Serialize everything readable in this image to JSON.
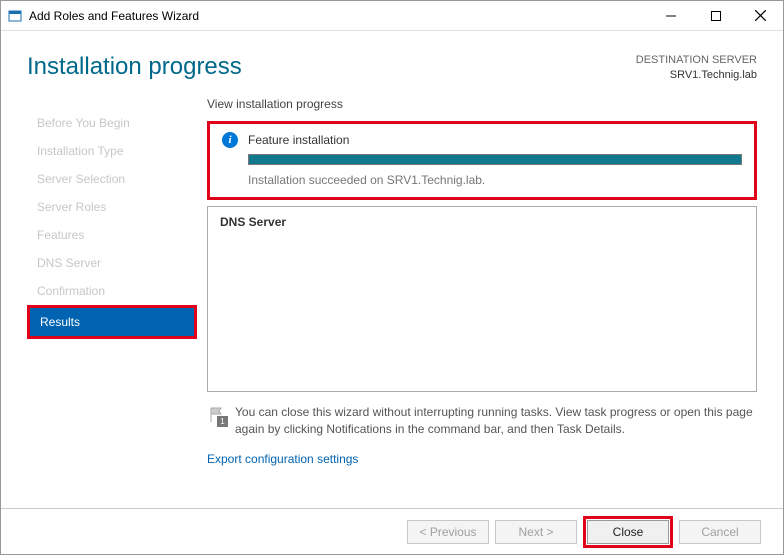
{
  "window": {
    "title": "Add Roles and Features Wizard"
  },
  "header": {
    "title": "Installation progress",
    "dest_label": "DESTINATION SERVER",
    "dest_server": "SRV1.Technig.lab"
  },
  "sidebar": {
    "steps": [
      "Before You Begin",
      "Installation Type",
      "Server Selection",
      "Server Roles",
      "Features",
      "DNS Server",
      "Confirmation",
      "Results"
    ],
    "active_index": 7
  },
  "main": {
    "sub": "View installation progress",
    "install_title": "Feature installation",
    "install_msg": "Installation succeeded on SRV1.Technig.lab.",
    "progress_pct": 100,
    "feature_name": "DNS Server",
    "hint": "You can close this wizard without interrupting running tasks. View task progress or open this page again by clicking Notifications in the command bar, and then Task Details.",
    "flag_count": "1",
    "export_link": "Export configuration settings"
  },
  "footer": {
    "previous": "< Previous",
    "next": "Next >",
    "close": "Close",
    "cancel": "Cancel"
  }
}
